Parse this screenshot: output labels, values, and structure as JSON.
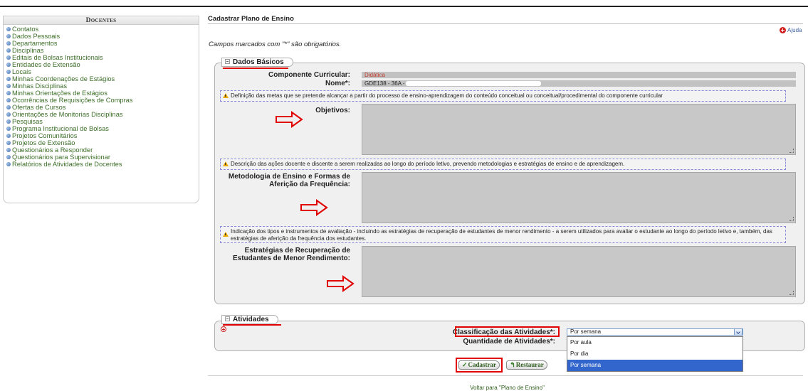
{
  "sidebar": {
    "title": "Docentes",
    "items": [
      "Contatos",
      "Dados Pessoais",
      "Departamentos",
      "Disciplinas",
      "Editais de Bolsas Institucionais",
      "Entidades de Extensão",
      "Locais",
      "Minhas Coordenações de Estágios",
      "Minhas Disciplinas",
      "Minhas Orientações de Estágios",
      "Ocorrências de Requisições de Compras",
      "Ofertas de Cursos",
      "Orientações de Monitorias Disciplinas",
      "Pesquisas",
      "Programa Institucional de Bolsas",
      "Projetos Comunitários",
      "Projetos de Extensão",
      "Questionários a Responder",
      "Questionários para Supervisionar",
      "Relatórios de Atividades de Docentes"
    ]
  },
  "main": {
    "title": "Cadastrar Plano de Ensino",
    "help_label": "Ajuda",
    "required_note": "Campos marcados com \"*\" são obrigatórios.",
    "dados_basicos": {
      "legend": "Dados Básicos",
      "componente_label": "Componente Curricular:",
      "componente_value": "Didática",
      "nome_label": "Nome*:",
      "nome_value": "GDE138 - 36A -",
      "objetivos_hint": "Definição das metas que se pretende alcançar a partir do processo de ensino-aprendizagem do conteúdo conceitual ou conceitual/procedimental do componente curricular",
      "objetivos_label": "Objetivos:",
      "metodologia_hint": "Descrição das ações docente e discente a serem realizadas ao longo do período letivo, prevendo metodologias e estratégias de ensino e de aprendizagem.",
      "metodologia_label_1": "Metodologia de Ensino e Formas de",
      "metodologia_label_2": "Aferição da Frequência:",
      "estrategias_hint": "Indicação dos tipos e instrumentos de avaliação - incluindo as estratégias de recuperação de estudantes de menor rendimento - a serem utilizados para avaliar o estudante ao longo do período letivo e, também, das estratégias de aferição da frequência dos estudantes.",
      "estrategias_label_1": "Estratégias de Recuperação de",
      "estrategias_label_2": "Estudantes de Menor Rendimento:"
    },
    "atividades": {
      "legend": "Atividades",
      "classificacao_label": "Classificação das Atividades*:",
      "quantidade_label": "Quantidade de Atividades*:",
      "selected": "Por semana",
      "options": [
        "Por aula",
        "Por dia",
        "Por semana"
      ]
    },
    "buttons": {
      "cadastrar": "Cadastrar",
      "restaurar": "Restaurar"
    },
    "footer_link": "Voltar para \"Plano de Ensino\""
  },
  "colors": {
    "annotation_red": "#e00000",
    "link_green": "#3c6e28",
    "selected_blue": "#3366cc"
  }
}
